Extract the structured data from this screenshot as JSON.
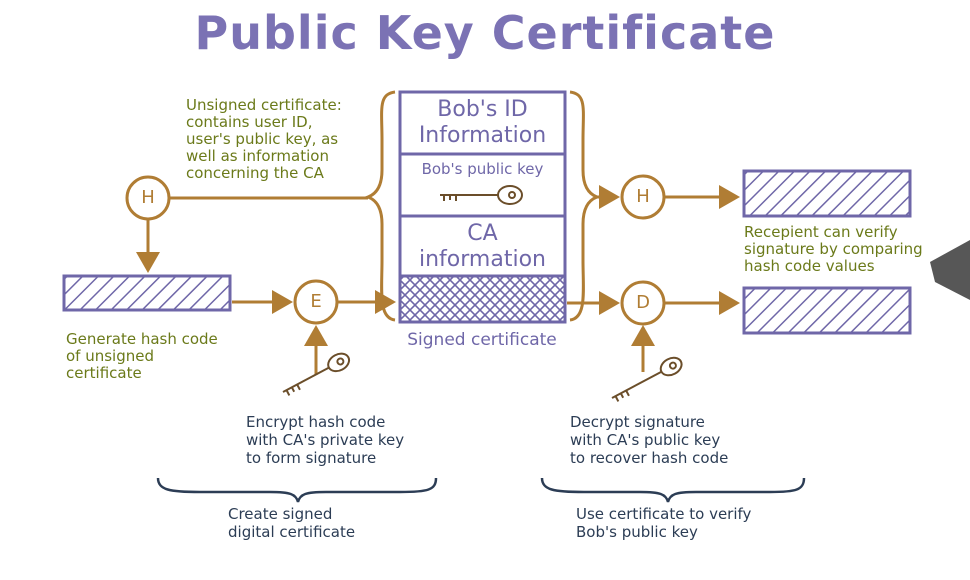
{
  "title": "Public Key Certificate",
  "unsigned_note": "Unsigned certificate:\ncontains user ID,\nuser's public key, as\nwell as information\nconcerning the CA",
  "cert_fields": {
    "bob_id": "Bob's ID\nInformation",
    "bob_key": "Bob's public key",
    "ca_info": "CA\ninformation"
  },
  "signed_label": "Signed certificate",
  "hash_note": "Generate hash code\nof unsigned\ncertificate",
  "ops": {
    "hash_left": "H",
    "encrypt": "E",
    "hash_right": "H",
    "decrypt": "D"
  },
  "encrypt_note": "Encrypt hash code\nwith CA's private key\nto form signature",
  "decrypt_note": "Decrypt signature\nwith CA's public key\nto recover hash code",
  "verify_note": "Recepient can verify\nsignature by comparing\nhash code values",
  "create_label": "Create signed\ndigital certificate",
  "use_label": "Use certificate to verify\nBob's public key",
  "colors": {
    "purple": "#6f67a8",
    "gold": "#b07d34",
    "olive": "#6b7a1a",
    "navy": "#2c3d55"
  }
}
